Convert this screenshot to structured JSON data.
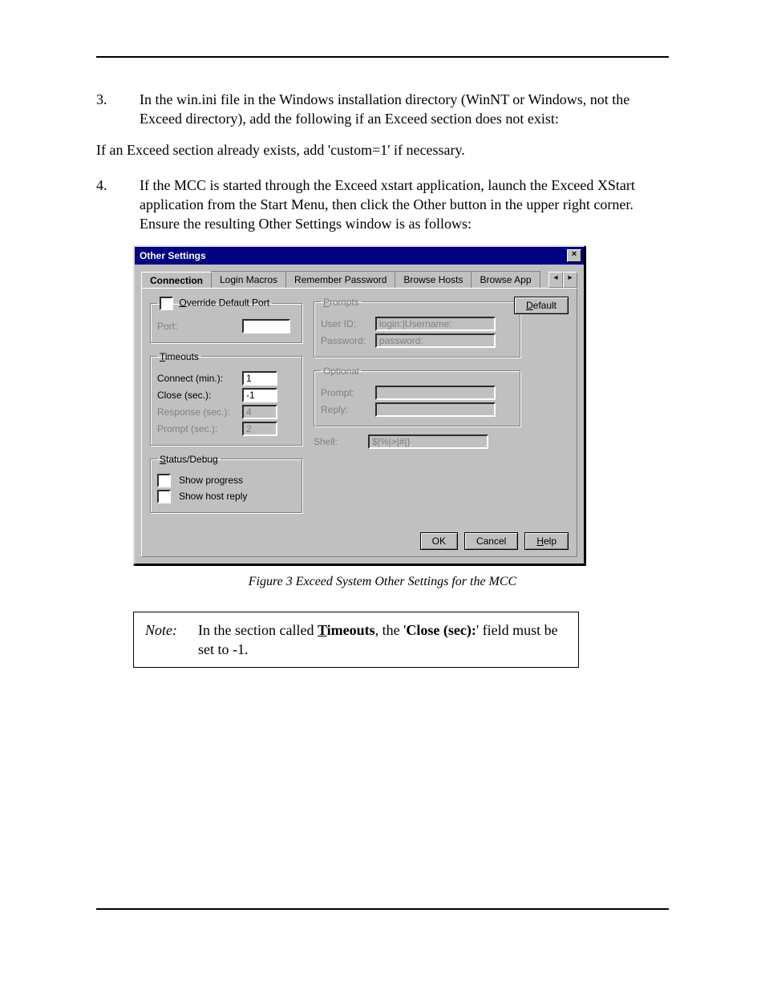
{
  "doc": {
    "step3_num": "3.",
    "step3_text": "In the win.ini file in the Windows installation directory (WinNT or Windows, not the Exceed directory), add the following if an Exceed section does not exist:",
    "mid_para": "If an Exceed section already exists, add 'custom=1' if necessary.",
    "step4_num": "4.",
    "step4_text": "If the MCC is started through the Exceed xstart application, launch the Exceed XStart application from the Start Menu, then click the Other button in the upper right corner. Ensure the resulting Other Settings window is as follows:",
    "figure_caption": "Figure 3 Exceed System Other Settings for the MCC",
    "note_label": "Note:",
    "note_pre": "In the section called ",
    "note_timeouts_lead": "T",
    "note_timeouts_rest": "imeouts",
    "note_mid": ", the '",
    "note_close": "Close (sec):",
    "note_post": "' field must be set to -1."
  },
  "dialog": {
    "title": "Other Settings",
    "close_glyph": "×",
    "tabs": {
      "connection": "Connection",
      "login_macros": "Login Macros",
      "remember_password": "Remember Password",
      "browse_hosts": "Browse Hosts",
      "browse_app": "Browse App"
    },
    "scroll_left": "◂",
    "scroll_right": "▸",
    "groups": {
      "override_port": {
        "checkbox_label": "Override Default Port",
        "checkbox_accel": "O",
        "port_label": "Port:",
        "port_value": ""
      },
      "timeouts": {
        "legend_accel": "T",
        "legend_rest": "imeouts",
        "connect_label": "Connect (min.):",
        "connect_value": "1",
        "close_label": "Close (sec.):",
        "close_value": "-1",
        "response_label": "Response (sec.):",
        "response_value": "4",
        "prompt_label": "Prompt (sec.):",
        "prompt_value": "2"
      },
      "status": {
        "legend_accel": "S",
        "legend_rest": "tatus/Debug",
        "show_progress": "Show progress",
        "show_host_reply": "Show host reply"
      },
      "prompts": {
        "legend_accel": "P",
        "legend_rest": "rompts",
        "userid_label": "User ID:",
        "userid_value": "login:|Username:",
        "password_label": "Password:",
        "password_value": "password:"
      },
      "optional": {
        "legend": "Optional",
        "prompt_label": "Prompt:",
        "prompt_value": "",
        "reply_label": "Reply:",
        "reply_value": ""
      },
      "shell": {
        "label": "Shell:",
        "value": "$|%|>|#|}"
      }
    },
    "buttons": {
      "default_accel": "D",
      "default_rest": "efault",
      "ok": "OK",
      "cancel": "Cancel",
      "help_accel": "H",
      "help_rest": "elp"
    }
  }
}
